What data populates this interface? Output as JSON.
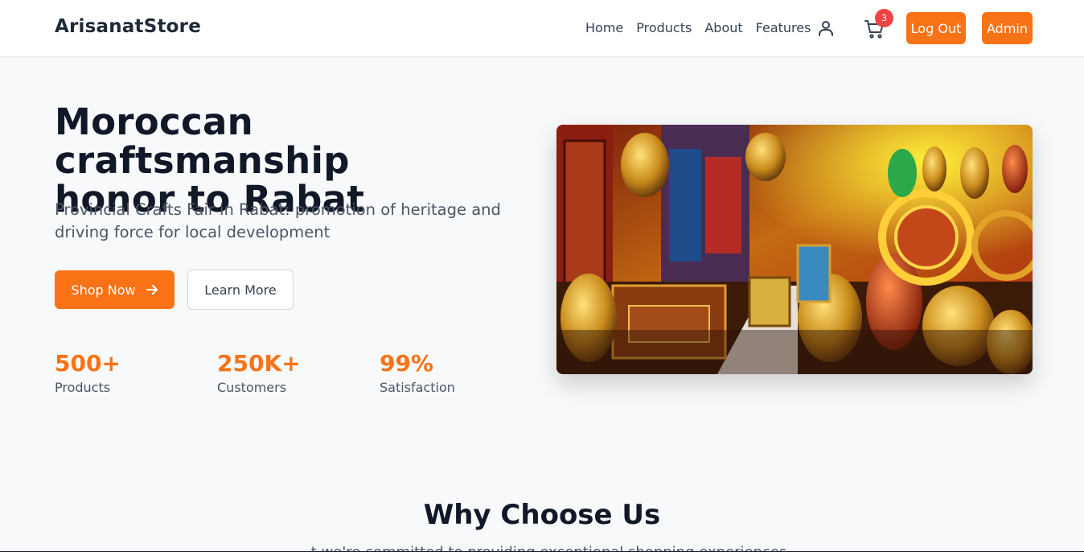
{
  "navbar": {
    "brand": "ArisanatStore",
    "links": [
      "Home",
      "Products",
      "About",
      "Features"
    ],
    "cart_count": "3",
    "logout_label": "Log Out",
    "admin_label": "Admin"
  },
  "hero": {
    "title_line1": "Moroccan craftsmanship",
    "title_line2": "honor to Rabat",
    "subtitle": "Provincial Crafts Fair in Rabat: promotion of heritage and driving force for local development",
    "shop_label": "Shop Now",
    "learn_label": "Learn More",
    "stats": [
      {
        "value": "500+",
        "label": "Products"
      },
      {
        "value": "250K+",
        "label": "Customers"
      },
      {
        "value": "99%",
        "label": "Satisfaction"
      }
    ]
  },
  "why": {
    "title": "Why Choose Us",
    "subtitle": "...t we're committed to providing exceptional shopping experiences"
  },
  "colors": {
    "accent": "#f97316",
    "badge": "#ef4444",
    "heading": "#111827",
    "body_text": "#4b5563",
    "background": "#f8f9fb"
  },
  "icons": [
    "user-icon",
    "cart-icon",
    "arrow-right-icon"
  ]
}
